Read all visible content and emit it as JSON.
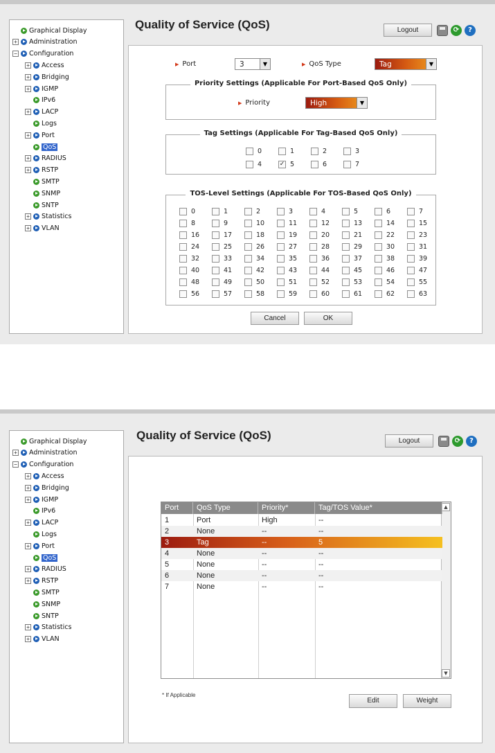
{
  "tree": [
    {
      "label": "Graphical Display",
      "exp": "",
      "indent": 0,
      "color": "green"
    },
    {
      "label": "Administration",
      "exp": "+",
      "indent": 0,
      "color": "blue"
    },
    {
      "label": "Configuration",
      "exp": "−",
      "indent": 0,
      "color": "blue"
    },
    {
      "label": "Access",
      "exp": "+",
      "indent": 1,
      "color": "blue"
    },
    {
      "label": "Bridging",
      "exp": "+",
      "indent": 1,
      "color": "blue"
    },
    {
      "label": "IGMP",
      "exp": "+",
      "indent": 1,
      "color": "blue"
    },
    {
      "label": "IPv6",
      "exp": "",
      "indent": 1,
      "color": "green"
    },
    {
      "label": "LACP",
      "exp": "+",
      "indent": 1,
      "color": "blue"
    },
    {
      "label": "Logs",
      "exp": "",
      "indent": 1,
      "color": "green"
    },
    {
      "label": "Port",
      "exp": "+",
      "indent": 1,
      "color": "blue"
    },
    {
      "label": "QoS",
      "exp": "",
      "indent": 1,
      "color": "green",
      "selected": true
    },
    {
      "label": "RADIUS",
      "exp": "+",
      "indent": 1,
      "color": "blue"
    },
    {
      "label": "RSTP",
      "exp": "+",
      "indent": 1,
      "color": "blue"
    },
    {
      "label": "SMTP",
      "exp": "",
      "indent": 1,
      "color": "green"
    },
    {
      "label": "SNMP",
      "exp": "",
      "indent": 1,
      "color": "green"
    },
    {
      "label": "SNTP",
      "exp": "",
      "indent": 1,
      "color": "green"
    },
    {
      "label": "Statistics",
      "exp": "+",
      "indent": 1,
      "color": "blue"
    },
    {
      "label": "VLAN",
      "exp": "+",
      "indent": 1,
      "color": "blue"
    }
  ],
  "header": {
    "title": "Quality of Service (QoS)",
    "logout_label": "Logout"
  },
  "icons": {
    "save": "save-icon",
    "refresh": "refresh-icon",
    "help": "help-icon"
  },
  "top": {
    "port_label": "Port",
    "port_value": "3",
    "qos_type_label": "QoS Type",
    "qos_type_value": "Tag",
    "priority_legend": "Priority Settings (Applicable For Port-Based QoS Only)",
    "priority_label": "Priority",
    "priority_value": "High",
    "tag_legend": "Tag Settings (Applicable For Tag-Based QoS Only)",
    "tag_checked": [
      5
    ],
    "tos_legend": "TOS-Level Settings (Applicable For TOS-Based QoS Only)",
    "tos_checked": [],
    "cancel_label": "Cancel",
    "ok_label": "OK"
  },
  "bottom": {
    "columns": [
      "Port",
      "QoS Type",
      "Priority*",
      "Tag/TOS Value*"
    ],
    "rows": [
      [
        "1",
        "Port",
        "High",
        "--"
      ],
      [
        "2",
        "None",
        "--",
        "--"
      ],
      [
        "3",
        "Tag",
        "--",
        "5"
      ],
      [
        "4",
        "None",
        "--",
        "--"
      ],
      [
        "5",
        "None",
        "--",
        "--"
      ],
      [
        "6",
        "None",
        "--",
        "--"
      ],
      [
        "7",
        "None",
        "--",
        "--"
      ]
    ],
    "highlight_row": 2,
    "footnote": "* If Applicable",
    "edit_label": "Edit",
    "weight_label": "Weight"
  },
  "colors": {
    "accent_start": "#9c1b0f",
    "accent_end": "#f0a020",
    "selected_nav": "#3366cc"
  }
}
